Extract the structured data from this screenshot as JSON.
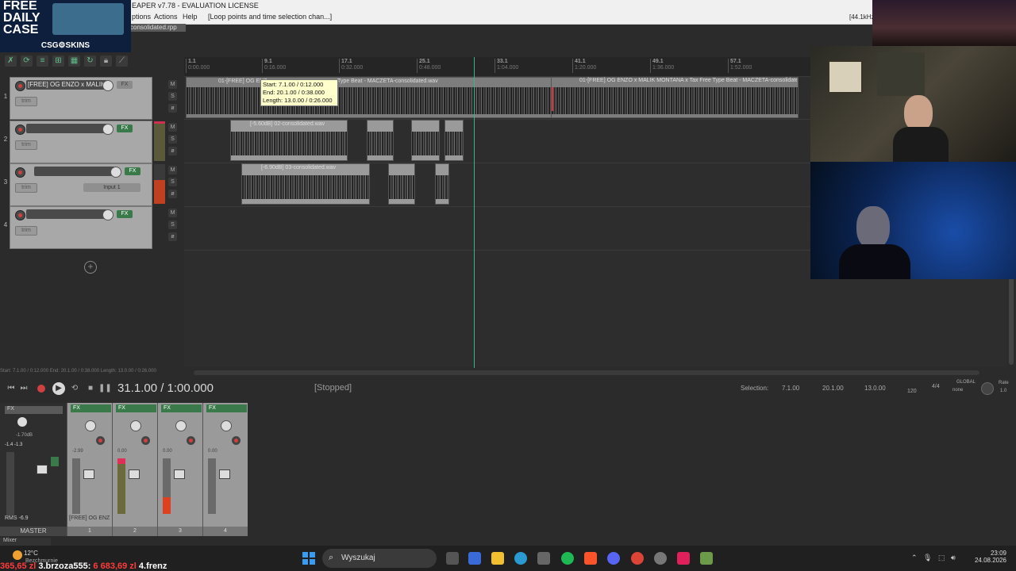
{
  "window": {
    "title": "EAPER v7.78 - EVALUATION LICENSE",
    "sample_rate": "[44.1kHz",
    "project_tab": "consolidated.rpp"
  },
  "menu": {
    "items": [
      "ptions",
      "Actions",
      "Help",
      "[Loop points and time selection chan...]"
    ]
  },
  "promo": {
    "title": "FREE DAILY CASE",
    "brand": "CSG⚙SKINS"
  },
  "ruler": {
    "marks": [
      {
        "bar": "1.1",
        "time": "0:00.000"
      },
      {
        "bar": "9.1",
        "time": "0:16.000"
      },
      {
        "bar": "17.1",
        "time": "0:32.000"
      },
      {
        "bar": "25.1",
        "time": "0:48.000"
      },
      {
        "bar": "33.1",
        "time": "1:04.000"
      },
      {
        "bar": "41.1",
        "time": "1:20.000"
      },
      {
        "bar": "49.1",
        "time": "1:36.000"
      },
      {
        "bar": "57.1",
        "time": "1:52.000"
      }
    ]
  },
  "tooltip": {
    "start": "Start: 7.1.00 / 0:12.000",
    "end": "End: 20.1.00 / 0:38.000",
    "length": "Length: 13.0.00 / 0:26.000"
  },
  "tracks": [
    {
      "num": "1",
      "name": "[FREE] OG ENZO x MALIK",
      "fx": "FX",
      "trim": "trim"
    },
    {
      "num": "2",
      "name": "",
      "fx": "FX",
      "trim": "trim"
    },
    {
      "num": "3",
      "name": "",
      "fx": "FX",
      "trim": "trim",
      "input": "Input 1"
    },
    {
      "num": "4",
      "name": "",
      "fx": "FX",
      "trim": "trim"
    }
  ],
  "items": {
    "t1a": "01-[FREE] OG ENZ",
    "t1b": "Type Beat - MACZETA-consolidated.wav",
    "t1c": "01-[FREE] OG ENZO x MALIK MONTANA x Tax Free Type Beat - MACZETA-consolidated.wav",
    "t2": "[-5.60dB] 02-consolidated.wav",
    "t3": "[-6.90dB] 03-consolidated.wav"
  },
  "status_strip": "Start: 7.1.00 / 0:12.000 End: 20.1.00 / 0:38.000 Length: 13.0.00 / 0:26.000",
  "transport": {
    "time": "31.1.00 / 1:00.000",
    "state": "[Stopped]",
    "selection_label": "Selection:",
    "sel_start": "7.1.00",
    "sel_end": "20.1.00",
    "sel_length": "13.0.00",
    "bpm": "120",
    "signature": "4/4",
    "global": "GLOBAL",
    "global_sub": "none",
    "rate_label": "Rate",
    "rate": "1.0"
  },
  "mixer": {
    "master_label": "MASTER",
    "master_readout": "-1.70dB",
    "master_peak": "-1.4  -1.3",
    "rms_label": "RMS",
    "rms_value": "-6.9",
    "strips": [
      {
        "num": "1",
        "vol": "-2.99",
        "name": "[FREE] OG ENZ"
      },
      {
        "num": "2",
        "vol": "0.00",
        "name": ""
      },
      {
        "num": "3",
        "vol": "0.00",
        "name": ""
      },
      {
        "num": "4",
        "vol": "0.00",
        "name": ""
      }
    ],
    "tab": "Mixer",
    "fx": "FX",
    "route": "Route"
  },
  "taskbar": {
    "temperature": "12°C",
    "weather": "Bezchmurnie",
    "search_placeholder": "Wyszukaj",
    "time": "23:09",
    "date": "24.08.2026"
  },
  "ticker": {
    "prefix": "365,65 zl",
    "rank3": "3.brzoza555:",
    "amount3": "6 683,69 zl",
    "rank4": "4.frenz"
  },
  "colors": {
    "accent_green": "#3fae8e",
    "record_red": "#d04040",
    "tooltip_bg": "#ffffcc"
  }
}
